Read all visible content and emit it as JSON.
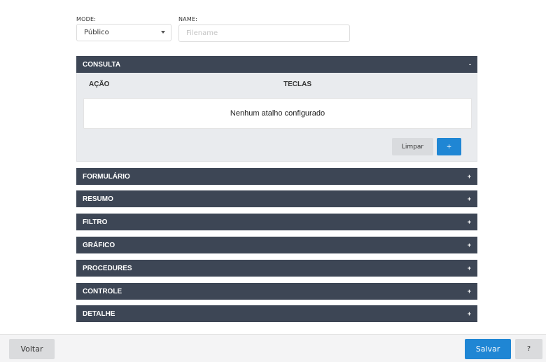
{
  "form": {
    "mode_label": "MODE:",
    "mode_value": "Público",
    "name_label": "NAME:",
    "name_value": "",
    "name_placeholder": "Filename"
  },
  "consulta": {
    "title": "CONSULTA",
    "toggle": "-",
    "col_action": "AÇÃO",
    "col_keys": "TECLAS",
    "empty_message": "Nenhum atalho configurado",
    "clear_label": "Limpar",
    "add_label": "+"
  },
  "sections": [
    {
      "title": "FORMULÁRIO",
      "toggle": "+"
    },
    {
      "title": "RESUMO",
      "toggle": "+"
    },
    {
      "title": "FILTRO",
      "toggle": "+"
    },
    {
      "title": "GRÁFICO",
      "toggle": "+"
    },
    {
      "title": "PROCEDURES",
      "toggle": "+"
    },
    {
      "title": "CONTROLE",
      "toggle": "+"
    },
    {
      "title": "DETALHE",
      "toggle": "+"
    }
  ],
  "footer": {
    "back_label": "Voltar",
    "save_label": "Salvar",
    "help_label": "?"
  }
}
